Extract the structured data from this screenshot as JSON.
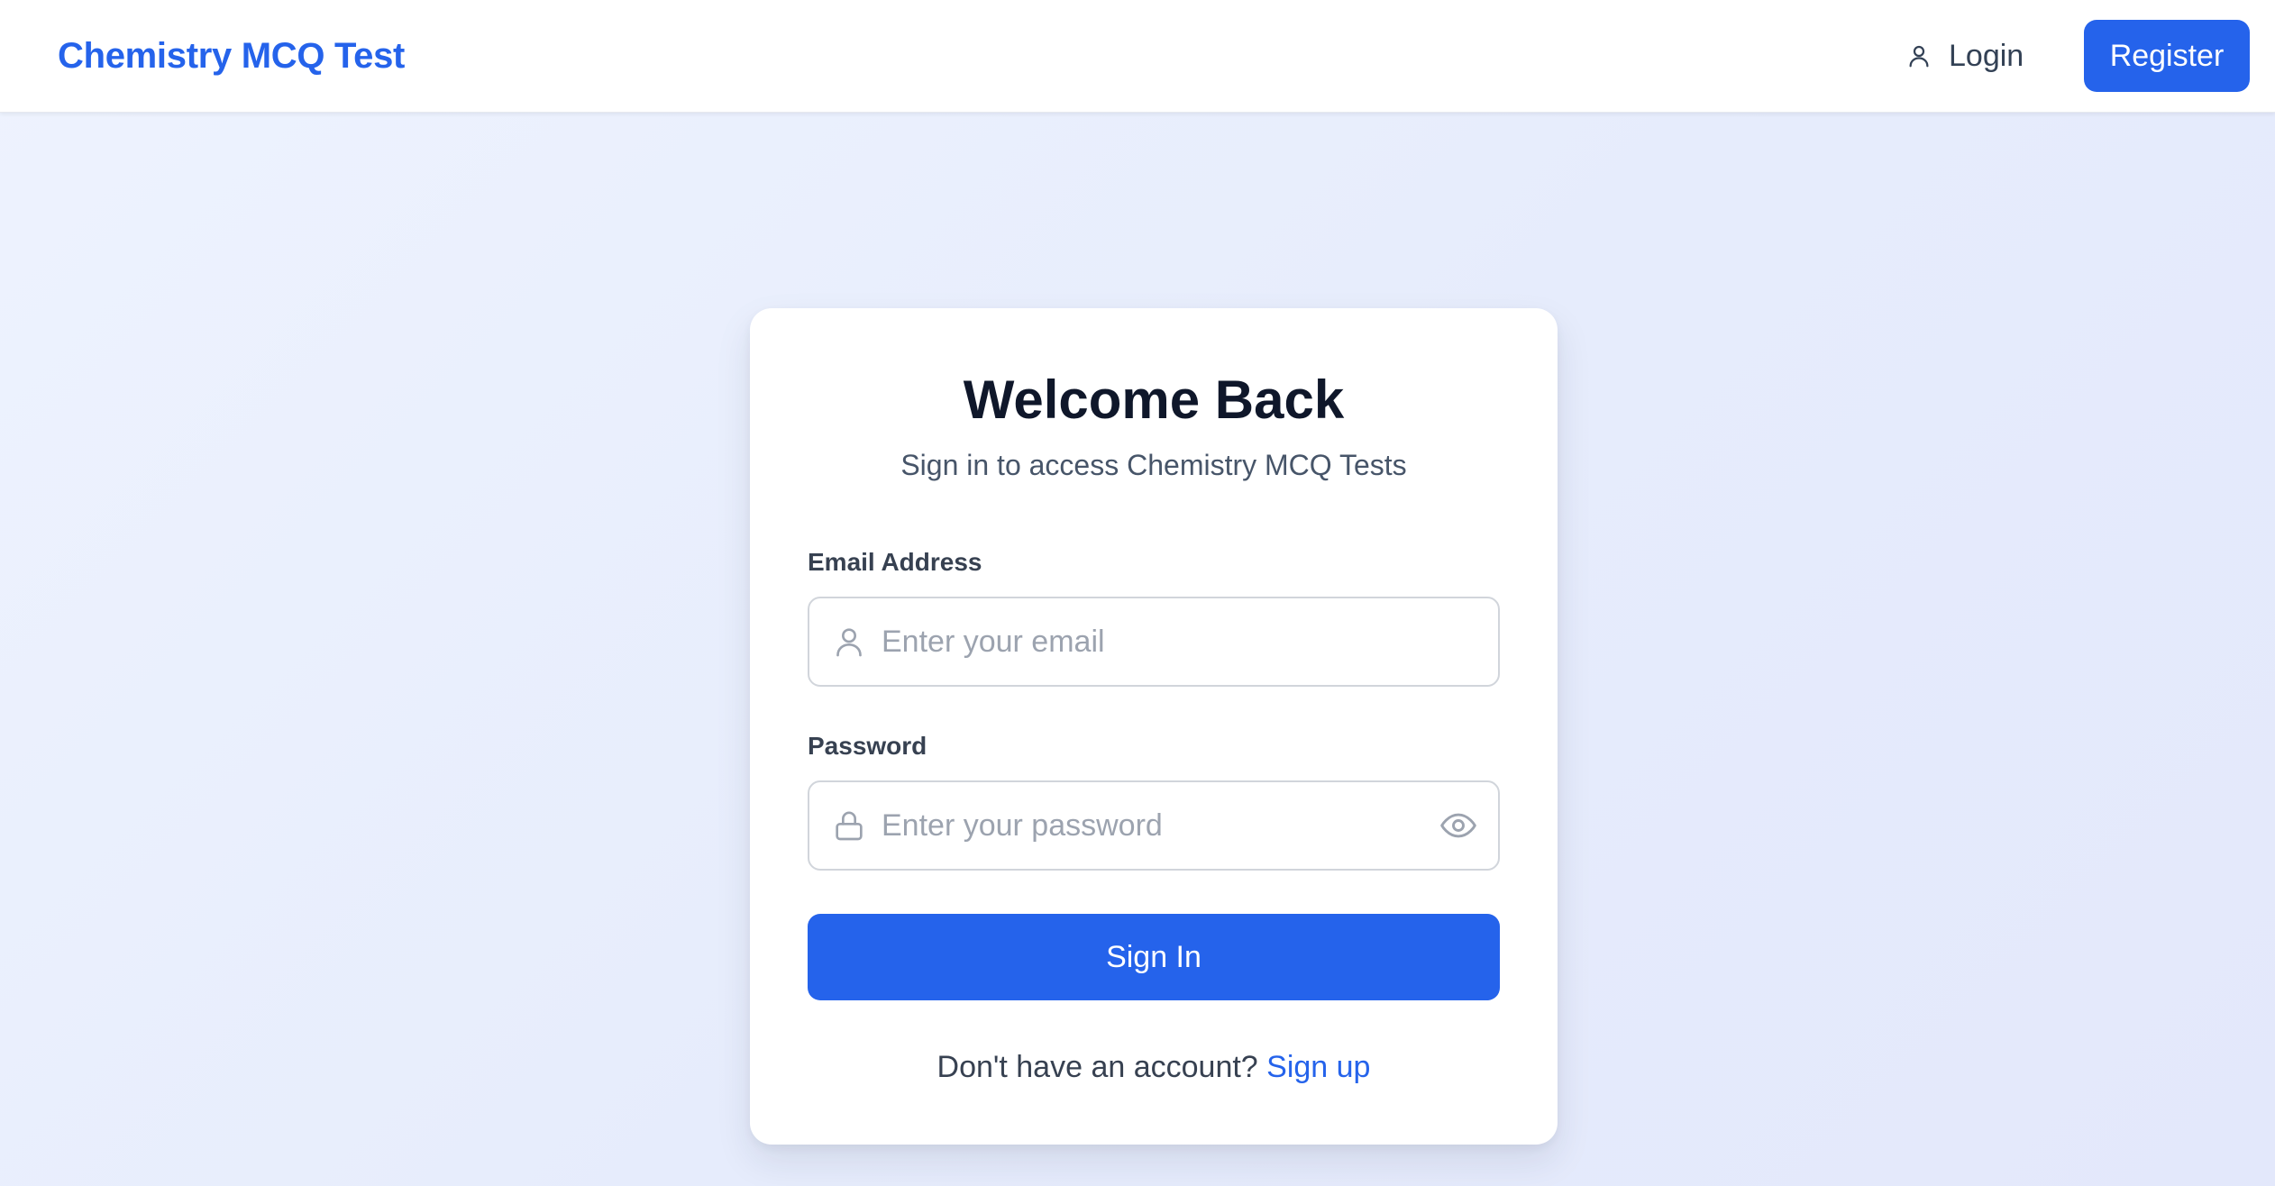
{
  "header": {
    "brand": "Chemistry MCQ Test",
    "login_label": "Login",
    "register_label": "Register"
  },
  "card": {
    "title": "Welcome Back",
    "subtitle": "Sign in to access Chemistry MCQ Tests",
    "email": {
      "label": "Email Address",
      "placeholder": "Enter your email",
      "value": ""
    },
    "password": {
      "label": "Password",
      "placeholder": "Enter your password",
      "value": ""
    },
    "submit_label": "Sign In",
    "signup_prompt": "Don't have an account?",
    "signup_link": "Sign up"
  },
  "icons": {
    "login": "user-icon",
    "email": "user-icon",
    "password": "lock-icon",
    "toggle": "eye-icon"
  },
  "colors": {
    "accent": "#2563eb",
    "heading": "#0f172a",
    "muted": "#475569",
    "placeholder": "#9ca3af",
    "border": "#d1d5db"
  }
}
